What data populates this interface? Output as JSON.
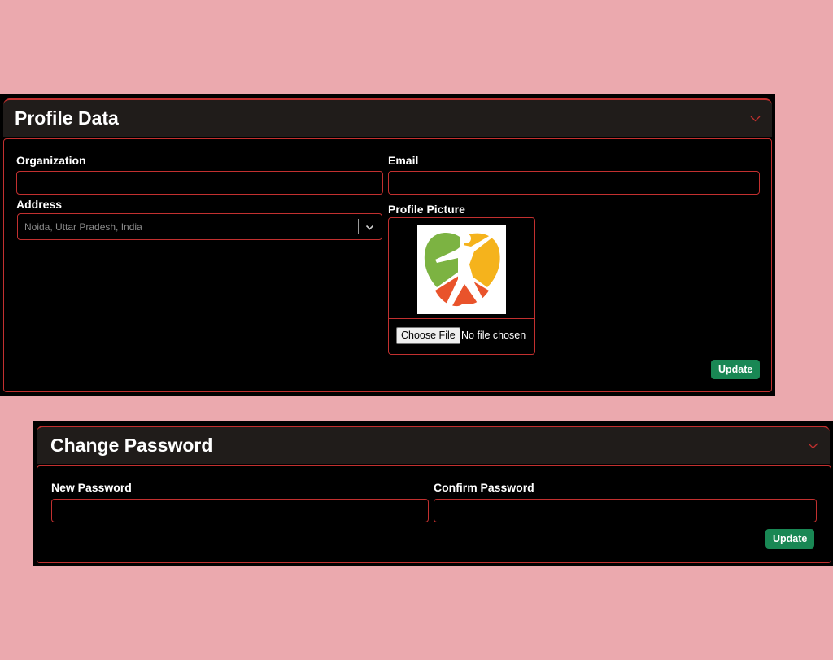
{
  "profile": {
    "title": "Profile Data",
    "organization": {
      "label": "Organization",
      "value": ""
    },
    "email": {
      "label": "Email",
      "value": ""
    },
    "address": {
      "label": "Address",
      "value": "Noida, Uttar Pradesh, India"
    },
    "profile_picture": {
      "label": "Profile Picture",
      "choose_file_label": "Choose File",
      "file_status": "No file chosen"
    },
    "update_label": "Update"
  },
  "password": {
    "title": "Change Password",
    "new_password": {
      "label": "New Password",
      "value": ""
    },
    "confirm_password": {
      "label": "Confirm Password",
      "value": ""
    },
    "update_label": "Update"
  },
  "icons": {
    "header_chevron": "chevron-down-icon",
    "select_chevron": "chevron-down-icon",
    "logo": "heart-figure-logo"
  },
  "colors": {
    "page_bg": "#eba9ae",
    "panel_bg": "#000000",
    "header_bg": "#201c1a",
    "accent_red": "#c2302f",
    "update_green": "#198754",
    "logo_green": "#7cb342",
    "logo_yellow": "#f5b31c",
    "logo_orange": "#e9532b"
  }
}
